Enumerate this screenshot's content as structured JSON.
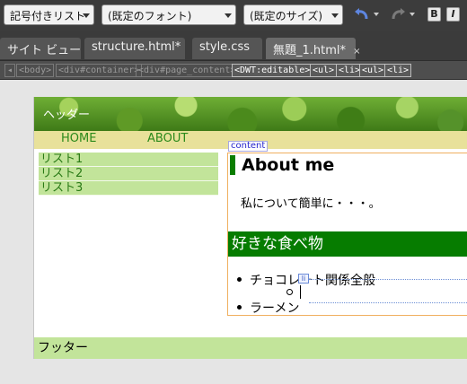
{
  "toolbar": {
    "format_select": "記号付きリスト",
    "font_select": "(既定のフォント)",
    "size_select": "(既定のサイズ)",
    "undo_icon": "undo-icon",
    "redo_icon": "redo-icon",
    "bold_label": "B",
    "italic_label": "I"
  },
  "tabs": [
    {
      "label": "サイト ビュー"
    },
    {
      "label": "structure.html*"
    },
    {
      "label": "style.css"
    },
    {
      "label": "無題_1.html*",
      "close": "×"
    }
  ],
  "tagbar": {
    "nav_left": "◂",
    "tags": [
      "<body>",
      "<div#container>",
      "<div#page_content>",
      "<DWT:editable>",
      "<ul>",
      "<li>",
      "<ul>",
      "<li>"
    ]
  },
  "page": {
    "header_text": "ヘッダー",
    "nav": [
      "HOME",
      "ABOUT"
    ],
    "sidebar": [
      "リスト1",
      "リスト2",
      "リスト3"
    ],
    "content_label": "content",
    "heading": "About me",
    "paragraph": "私について簡単に・・・。",
    "subheading": "好きな食べ物",
    "list": [
      "チョコレート関係全般",
      "ラーメン"
    ],
    "li_marker": "li",
    "footer": "フッター"
  },
  "colors": {
    "nav_bg": "#e8e19a",
    "sidebar_bg": "#c2e49a",
    "heading_green": "#067c00",
    "content_border": "#f0b060"
  }
}
